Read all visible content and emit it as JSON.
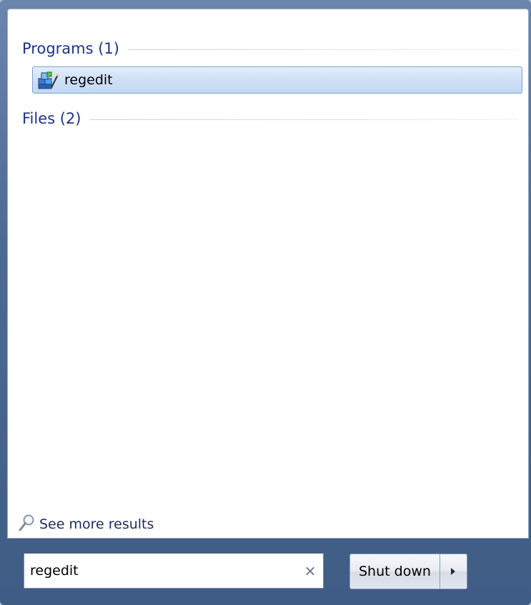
{
  "results": {
    "programs_header": "Programs (1)",
    "files_header": "Files (2)",
    "program_items": [
      {
        "label": "regedit",
        "icon": "registry-editor-icon"
      }
    ],
    "see_more_label": "See more results"
  },
  "search": {
    "value": "regedit",
    "clear_glyph": "×"
  },
  "shutdown": {
    "label": "Shut down"
  },
  "colors": {
    "header_text": "#1e3287",
    "selection_border": "#7da2ce",
    "frame": "#4d6a93"
  }
}
